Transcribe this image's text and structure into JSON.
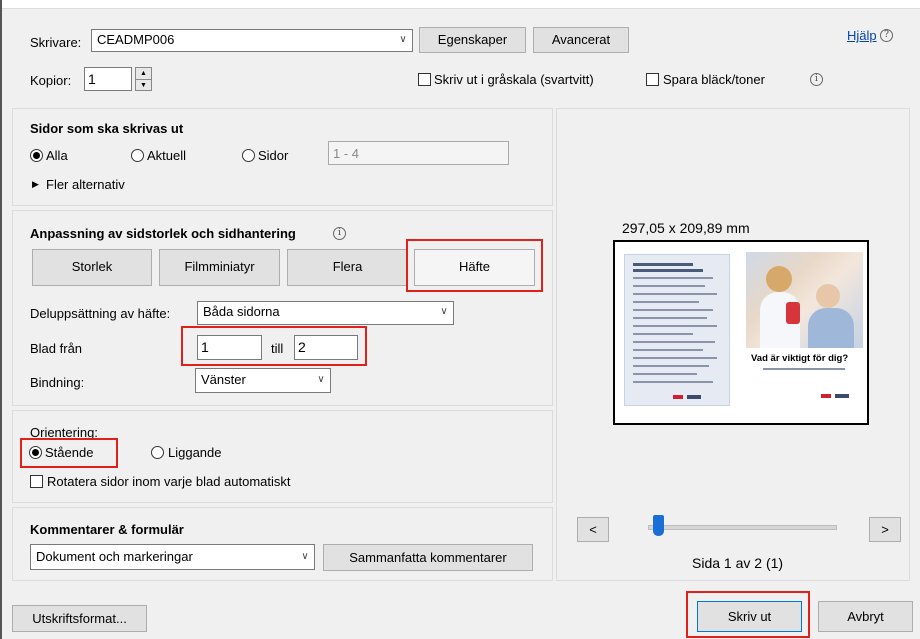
{
  "header": {
    "printer_label": "Skrivare:",
    "printer_value": "CEADMP006",
    "properties_button": "Egenskaper",
    "advanced_button": "Avancerat",
    "help_link": "Hjälp",
    "copies_label": "Kopior:",
    "copies_value": "1",
    "grayscale_label": "Skriv ut i gråskala (svartvitt)",
    "save_ink_label": "Spara bläck/toner"
  },
  "pages_section": {
    "title": "Sidor som ska skrivas ut",
    "opt_all": "Alla",
    "opt_current": "Aktuell",
    "opt_pages": "Sidor",
    "pages_placeholder": "1 - 4",
    "more_options": "Fler alternativ"
  },
  "sizing_section": {
    "title": "Anpassning av sidstorlek och sidhantering",
    "tab_size": "Storlek",
    "tab_poster": "Filmminiatyr",
    "tab_multiple": "Flera",
    "tab_booklet": "Häfte",
    "subset_label": "Deluppsättning av häfte:",
    "subset_value": "Båda sidorna",
    "sheets_from_label": "Blad från",
    "sheets_from_value": "1",
    "sheets_to_label": "till",
    "sheets_to_value": "2",
    "binding_label": "Bindning:",
    "binding_value": "Vänster"
  },
  "orientation_section": {
    "title": "Orientering:",
    "opt_portrait": "Stående",
    "opt_landscape": "Liggande",
    "auto_rotate": "Rotatera sidor inom varje blad automatiskt"
  },
  "comments_section": {
    "title": "Kommentarer & formulär",
    "value": "Dokument och markeringar",
    "summarize_button": "Sammanfatta kommentarer"
  },
  "preview": {
    "dimensions": "297,05 x 209,89 mm",
    "headline": "Vad är viktigt för dig?",
    "prev_button": "<",
    "next_button": ">",
    "page_status": "Sida 1 av 2 (1)",
    "slider_progress": 0.05
  },
  "footer": {
    "page_setup_button": "Utskriftsformat...",
    "print_button": "Skriv ut",
    "cancel_button": "Avbryt"
  },
  "colors": {
    "highlight_red": "#e0201b",
    "slider_blue": "#1a6fd6",
    "link_blue": "#0645ad"
  }
}
